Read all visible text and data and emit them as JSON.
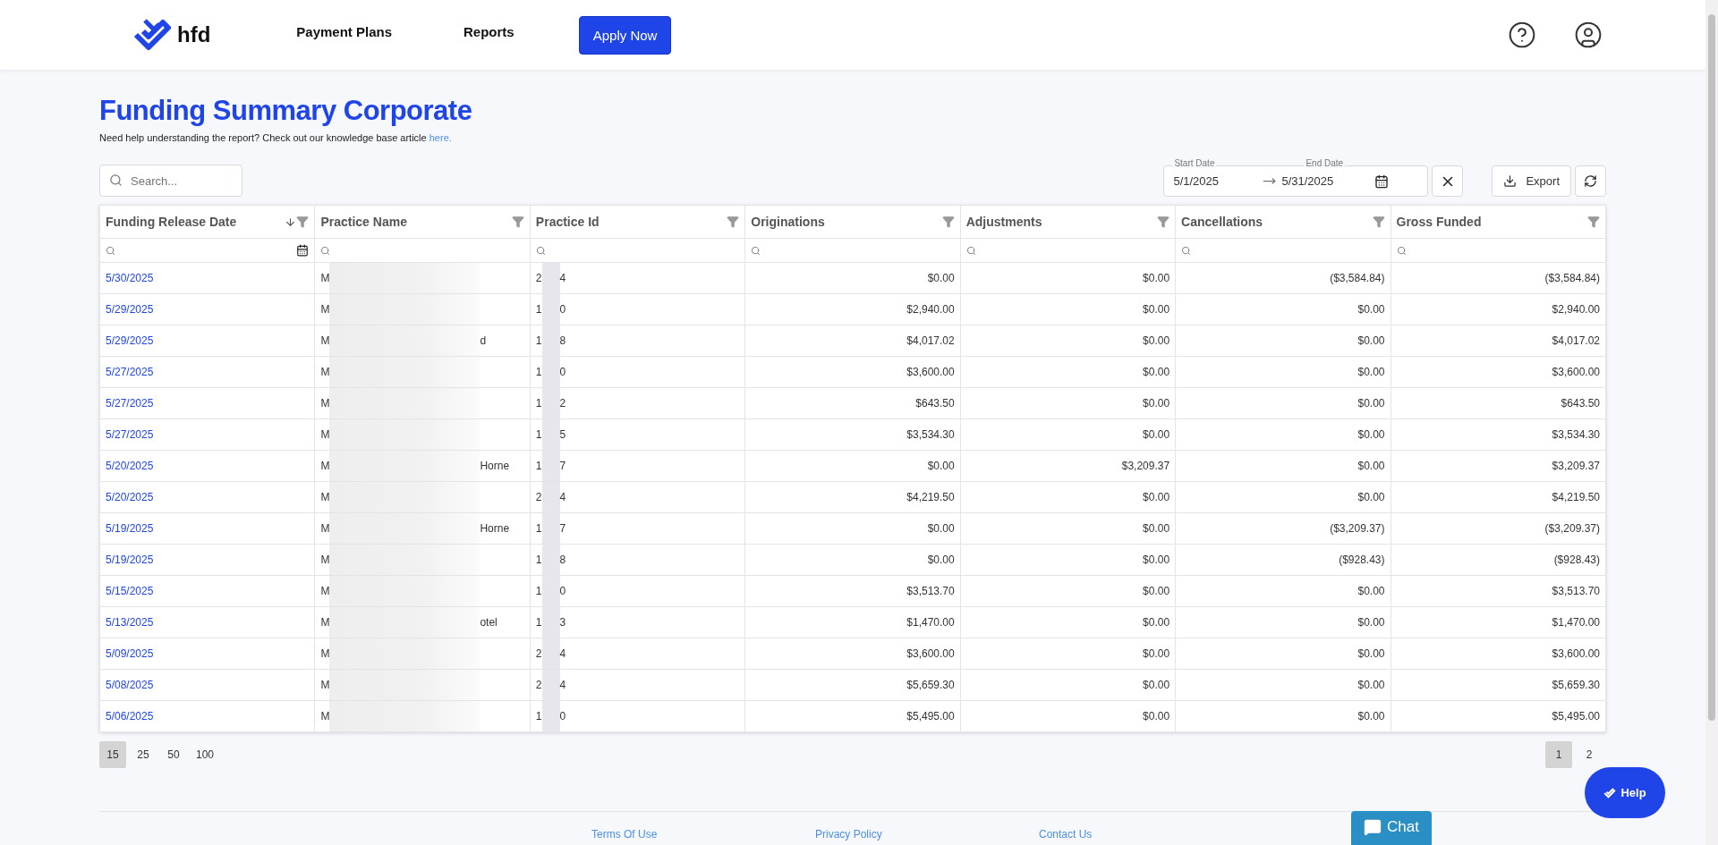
{
  "header": {
    "logo_text": "hfd",
    "nav": [
      {
        "label": "Payment Plans"
      },
      {
        "label": "Reports"
      }
    ],
    "apply_button": "Apply Now"
  },
  "page": {
    "title": "Funding Summary Corporate",
    "help_text": "Need help understanding the report? Check out our knowledge base article",
    "help_link": "here."
  },
  "toolbar": {
    "search": {
      "placeholder": "Search..."
    },
    "date_range": {
      "start_label": "Start Date",
      "start": "5/1/2025",
      "end_label": "End Date",
      "end": "5/31/2025"
    },
    "export_button": "Export"
  },
  "table": {
    "columns": [
      {
        "label": "Funding Release Date",
        "sorted": true
      },
      {
        "label": "Practice Name",
        "sorted": false
      },
      {
        "label": "Practice Id",
        "sorted": false
      },
      {
        "label": "Originations",
        "sorted": false
      },
      {
        "label": "Adjustments",
        "sorted": false
      },
      {
        "label": "Cancellations",
        "sorted": false
      },
      {
        "label": "Gross Funded",
        "sorted": false
      }
    ],
    "rows": [
      {
        "date": "5/30/2025",
        "name_start": "M",
        "name_end": "",
        "id_start": "2",
        "id_end": "4",
        "originations": "$0.00",
        "adjustments": "$0.00",
        "cancellations": "($3,584.84)",
        "gross_funded": "($3,584.84)"
      },
      {
        "date": "5/29/2025",
        "name_start": "M",
        "name_end": "",
        "id_start": "1",
        "id_end": "0",
        "originations": "$2,940.00",
        "adjustments": "$0.00",
        "cancellations": "$0.00",
        "gross_funded": "$2,940.00"
      },
      {
        "date": "5/29/2025",
        "name_start": "M",
        "name_end": "d",
        "id_start": "1",
        "id_end": "8",
        "originations": "$4,017.02",
        "adjustments": "$0.00",
        "cancellations": "$0.00",
        "gross_funded": "$4,017.02"
      },
      {
        "date": "5/27/2025",
        "name_start": "M",
        "name_end": "",
        "id_start": "1",
        "id_end": "0",
        "originations": "$3,600.00",
        "adjustments": "$0.00",
        "cancellations": "$0.00",
        "gross_funded": "$3,600.00"
      },
      {
        "date": "5/27/2025",
        "name_start": "M",
        "name_end": "",
        "id_start": "1",
        "id_end": "2",
        "originations": "$643.50",
        "adjustments": "$0.00",
        "cancellations": "$0.00",
        "gross_funded": "$643.50"
      },
      {
        "date": "5/27/2025",
        "name_start": "M",
        "name_end": "",
        "id_start": "1",
        "id_end": "5",
        "originations": "$3,534.30",
        "adjustments": "$0.00",
        "cancellations": "$0.00",
        "gross_funded": "$3,534.30"
      },
      {
        "date": "5/20/2025",
        "name_start": "M",
        "name_end": "Horne",
        "id_start": "1",
        "id_end": "7",
        "originations": "$0.00",
        "adjustments": "$3,209.37",
        "cancellations": "$0.00",
        "gross_funded": "$3,209.37"
      },
      {
        "date": "5/20/2025",
        "name_start": "M",
        "name_end": "",
        "id_start": "2",
        "id_end": "4",
        "originations": "$4,219.50",
        "adjustments": "$0.00",
        "cancellations": "$0.00",
        "gross_funded": "$4,219.50"
      },
      {
        "date": "5/19/2025",
        "name_start": "M",
        "name_end": "Horne",
        "id_start": "1",
        "id_end": "7",
        "originations": "$0.00",
        "adjustments": "$0.00",
        "cancellations": "($3,209.37)",
        "gross_funded": "($3,209.37)"
      },
      {
        "date": "5/19/2025",
        "name_start": "M",
        "name_end": "",
        "id_start": "1",
        "id_end": "8",
        "originations": "$0.00",
        "adjustments": "$0.00",
        "cancellations": "($928.43)",
        "gross_funded": "($928.43)"
      },
      {
        "date": "5/15/2025",
        "name_start": "M",
        "name_end": "",
        "id_start": "1",
        "id_end": "0",
        "originations": "$3,513.70",
        "adjustments": "$0.00",
        "cancellations": "$0.00",
        "gross_funded": "$3,513.70"
      },
      {
        "date": "5/13/2025",
        "name_start": "M",
        "name_end": "otel",
        "id_start": "1",
        "id_end": "3",
        "originations": "$1,470.00",
        "adjustments": "$0.00",
        "cancellations": "$0.00",
        "gross_funded": "$1,470.00"
      },
      {
        "date": "5/09/2025",
        "name_start": "M",
        "name_end": "",
        "id_start": "2",
        "id_end": "4",
        "originations": "$3,600.00",
        "adjustments": "$0.00",
        "cancellations": "$0.00",
        "gross_funded": "$3,600.00"
      },
      {
        "date": "5/08/2025",
        "name_start": "M",
        "name_end": "",
        "id_start": "2",
        "id_end": "4",
        "originations": "$5,659.30",
        "adjustments": "$0.00",
        "cancellations": "$0.00",
        "gross_funded": "$5,659.30"
      },
      {
        "date": "5/06/2025",
        "name_start": "M",
        "name_end": "",
        "id_start": "1",
        "id_end": "0",
        "originations": "$5,495.00",
        "adjustments": "$0.00",
        "cancellations": "$0.00",
        "gross_funded": "$5,495.00"
      }
    ]
  },
  "pagination": {
    "page_sizes": [
      {
        "label": "15",
        "selected": true
      },
      {
        "label": "25",
        "selected": false
      },
      {
        "label": "50",
        "selected": false
      },
      {
        "label": "100",
        "selected": false
      }
    ],
    "pages": [
      {
        "label": "1",
        "selected": true
      },
      {
        "label": "2",
        "selected": false
      }
    ]
  },
  "help_button": "Help",
  "chat_button": "Chat",
  "footer": {
    "links": [
      "Terms Of Use",
      "Privacy Policy",
      "Contact Us"
    ]
  }
}
